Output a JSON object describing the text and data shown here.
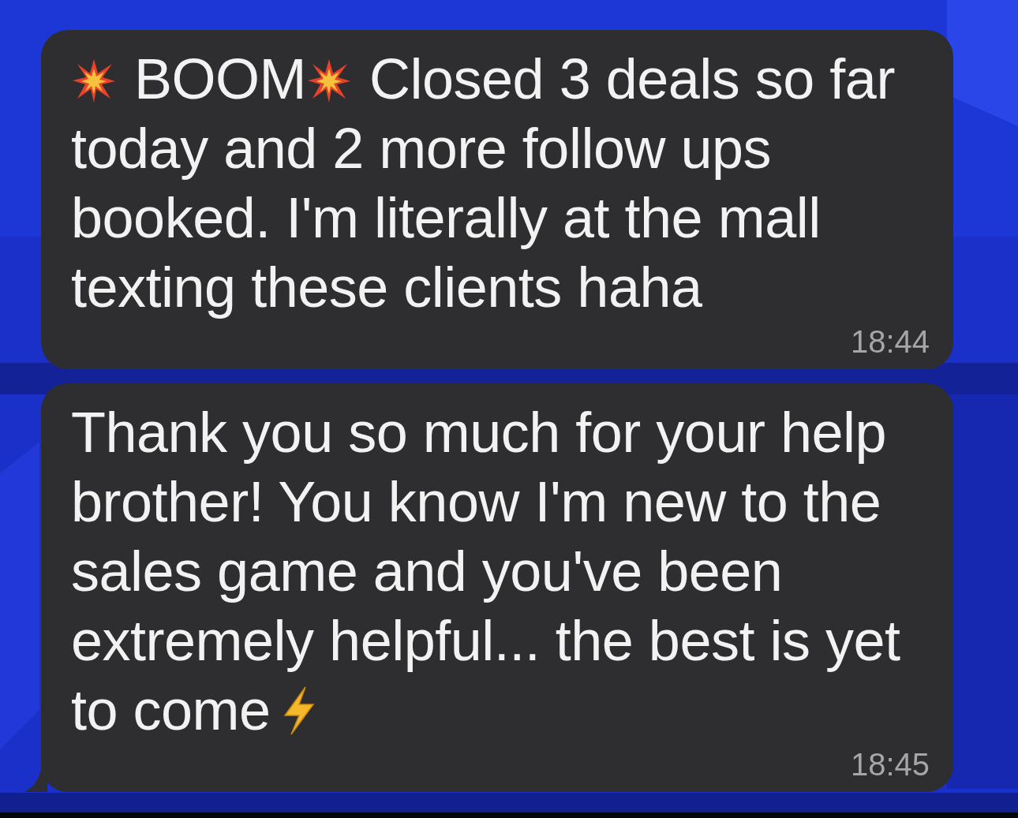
{
  "messages": [
    {
      "parts": [
        {
          "kind": "burst_icon"
        },
        {
          "kind": "text",
          "text": "BOOM"
        },
        {
          "kind": "burst_icon"
        },
        {
          "kind": "text",
          "text": "Closed 3 deals so far today and 2 more follow ups booked. I'm literally at the mall texting these clients haha"
        }
      ],
      "time": "18:44",
      "tail": false
    },
    {
      "parts": [
        {
          "kind": "text",
          "text": "Thank you so much for your help brother! You know I'm new to the sales game and you've been extremely helpful... the best is yet to come"
        },
        {
          "kind": "bolt_icon"
        }
      ],
      "time": "18:45",
      "tail": true
    }
  ]
}
